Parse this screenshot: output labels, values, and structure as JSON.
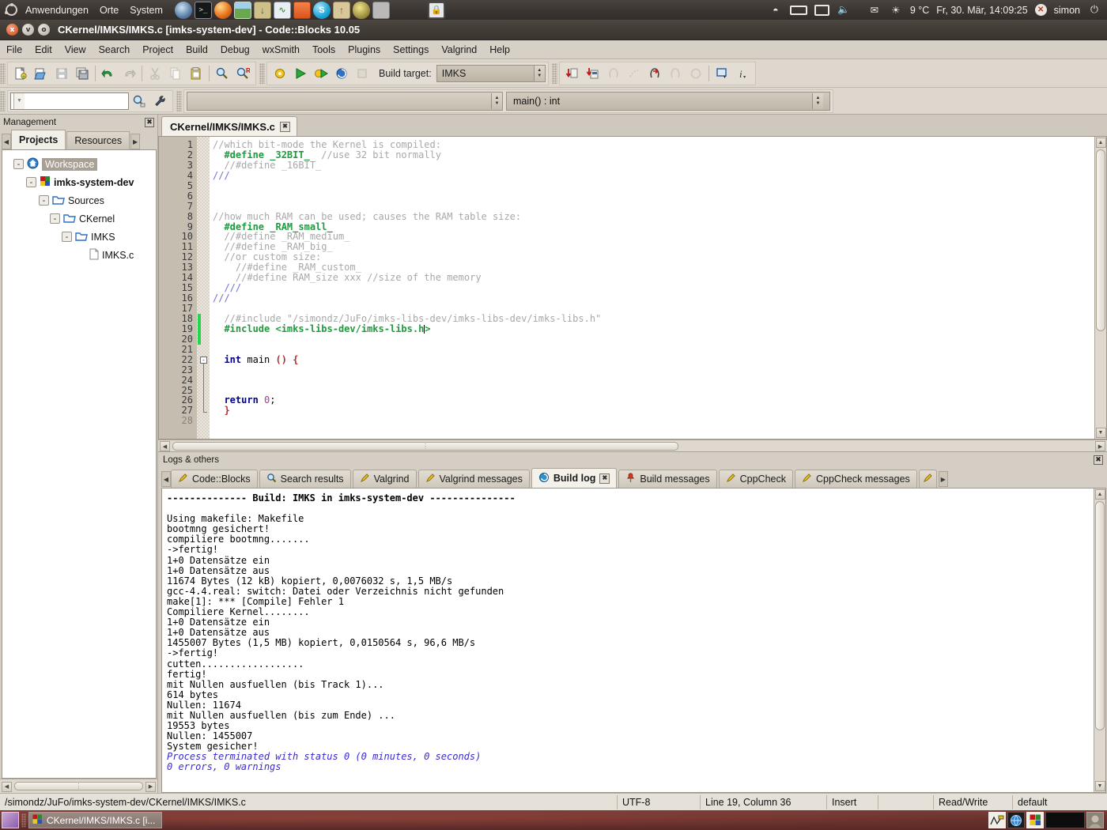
{
  "desktop": {
    "panel": {
      "menus": [
        "Anwendungen",
        "Orte",
        "System"
      ],
      "launchers": [
        "evolution-icon",
        "terminal-icon",
        "firefox-icon",
        "image-viewer-icon",
        "download-icon",
        "system-monitor-icon",
        "file-manager-icon",
        "skype-icon",
        "archive-icon",
        "mouse-icon",
        "calculator-icon",
        "screenlock-icon"
      ],
      "tray": [
        "wifi-icon",
        "battery-icon",
        "display-icon",
        "volume-icon",
        "mail-icon"
      ],
      "weather": "9 °C",
      "clock": "Fr, 30. Mär, 14:09:25",
      "user": "simon",
      "power_icon": "power-icon"
    },
    "taskbar": {
      "show_desktop": "show-desktop-icon",
      "buttons": [
        {
          "label": "CKernel/IMKS/IMKS.c [i...",
          "icon": "codeblocks-icon"
        }
      ],
      "tray": [
        "network-graph-icon",
        "globe-icon",
        "codeblocks-icon",
        "black-icon",
        "face-icon"
      ]
    }
  },
  "window": {
    "title": "CKernel/IMKS/IMKS.c [imks-system-dev] - Code::Blocks 10.05",
    "controls": {
      "close": "x",
      "minimize": "v",
      "maximize": "o"
    }
  },
  "menubar": {
    "items": [
      "File",
      "Edit",
      "View",
      "Search",
      "Project",
      "Build",
      "Debug",
      "wxSmith",
      "Tools",
      "Plugins",
      "Settings",
      "Valgrind",
      "Help"
    ]
  },
  "toolbar": {
    "main_icons": [
      "new-file-icon",
      "open-file-icon",
      "save-icon",
      "save-all-icon",
      "undo-icon",
      "redo-icon",
      "cut-icon",
      "copy-icon",
      "paste-icon",
      "find-icon",
      "replace-icon"
    ],
    "build_icons": [
      "build-icon",
      "run-icon",
      "build-and-run-icon",
      "rebuild-icon",
      "abort-icon"
    ],
    "build_target_label": "Build target:",
    "build_target_value": "IMKS",
    "debug_icons": [
      "debug-step-into-icon",
      "debug-step-out-icon",
      "debug-run-to-cursor-icon",
      "debug-next-line-icon",
      "debug-step-instruction-icon",
      "debug-next-instruction-icon",
      "debug-stop-icon",
      "debug-window-icon",
      "debug-info-icon"
    ],
    "search_placeholder": "",
    "search_value": "",
    "search_icons": [
      "find-in-files-icon",
      "settings-wrench-icon"
    ],
    "goto_value": "",
    "scope_value": "main() : int"
  },
  "management": {
    "header": "Management",
    "close_icon": "close-icon",
    "tabs": [
      {
        "label": "Projects",
        "active": true
      },
      {
        "label": "Resources",
        "active": false
      }
    ],
    "tree": [
      {
        "label": "Workspace",
        "depth": 0,
        "toggle": "-",
        "icon": "workspace-icon",
        "selected": true,
        "bold": false
      },
      {
        "label": "imks-system-dev",
        "depth": 1,
        "toggle": "-",
        "icon": "project-icon",
        "selected": false,
        "bold": true
      },
      {
        "label": "Sources",
        "depth": 2,
        "toggle": "-",
        "icon": "folder-icon",
        "selected": false,
        "bold": false
      },
      {
        "label": "CKernel",
        "depth": 3,
        "toggle": "-",
        "icon": "folder-icon",
        "selected": false,
        "bold": false
      },
      {
        "label": "IMKS",
        "depth": 4,
        "toggle": "-",
        "icon": "folder-icon",
        "selected": false,
        "bold": false
      },
      {
        "label": "IMKS.c",
        "depth": 5,
        "toggle": "",
        "icon": "file-icon",
        "selected": false,
        "bold": false
      }
    ]
  },
  "editor": {
    "tab_label": "CKernel/IMKS/IMKS.c",
    "tab_close_icon": "close-icon",
    "first_line": 1,
    "last_line": 28,
    "lines": [
      {
        "n": 1,
        "tokens": [
          {
            "t": "//which bit-mode the Kernel is compiled:",
            "c": "c-comment"
          }
        ]
      },
      {
        "n": 2,
        "tokens": [
          {
            "t": "  ",
            "c": "c-plain"
          },
          {
            "t": "#define _32BIT_",
            "c": "c-pre"
          },
          {
            "t": "  //use 32 bit normally",
            "c": "c-comment"
          }
        ]
      },
      {
        "n": 3,
        "tokens": [
          {
            "t": "  //#define _16BIT_",
            "c": "c-comment"
          }
        ]
      },
      {
        "n": 4,
        "tokens": [
          {
            "t": "///",
            "c": "c-comment3"
          }
        ]
      },
      {
        "n": 5,
        "tokens": []
      },
      {
        "n": 6,
        "tokens": []
      },
      {
        "n": 7,
        "tokens": []
      },
      {
        "n": 8,
        "tokens": [
          {
            "t": "//how much RAM can be used; causes the RAM table size:",
            "c": "c-comment"
          }
        ]
      },
      {
        "n": 9,
        "tokens": [
          {
            "t": "  ",
            "c": "c-plain"
          },
          {
            "t": "#define _RAM_small_",
            "c": "c-pre"
          }
        ]
      },
      {
        "n": 10,
        "tokens": [
          {
            "t": "  //#define _RAM_medium_",
            "c": "c-comment"
          }
        ]
      },
      {
        "n": 11,
        "tokens": [
          {
            "t": "  //#define _RAM_big_",
            "c": "c-comment"
          }
        ]
      },
      {
        "n": 12,
        "tokens": [
          {
            "t": "  //or custom size:",
            "c": "c-comment"
          }
        ]
      },
      {
        "n": 13,
        "tokens": [
          {
            "t": "    //#define _RAM_custom_",
            "c": "c-comment"
          }
        ]
      },
      {
        "n": 14,
        "tokens": [
          {
            "t": "    //#define RAM_size xxx //size of the memory",
            "c": "c-comment"
          }
        ]
      },
      {
        "n": 15,
        "tokens": [
          {
            "t": "  ///",
            "c": "c-comment3"
          }
        ]
      },
      {
        "n": 16,
        "tokens": [
          {
            "t": "///",
            "c": "c-comment3"
          }
        ]
      },
      {
        "n": 17,
        "tokens": []
      },
      {
        "n": 18,
        "tokens": [
          {
            "t": "  //#include \"/simondz/JuFo/imks-libs-dev/imks-libs-dev/imks-libs.h\"",
            "c": "c-comment"
          }
        ]
      },
      {
        "n": 19,
        "tokens": [
          {
            "t": "  ",
            "c": "c-plain"
          },
          {
            "t": "#include <imks-libs-dev/imks-libs.h",
            "c": "c-pre"
          },
          {
            "t": "CARET",
            "c": "caret"
          },
          {
            "t": ">",
            "c": "c-pre"
          }
        ]
      },
      {
        "n": 20,
        "tokens": []
      },
      {
        "n": 21,
        "tokens": []
      },
      {
        "n": 22,
        "tokens": [
          {
            "t": "  ",
            "c": "c-plain"
          },
          {
            "t": "int",
            "c": "c-kw"
          },
          {
            "t": " main ",
            "c": "c-plain"
          },
          {
            "t": "()",
            "c": "c-op"
          },
          {
            "t": " ",
            "c": "c-plain"
          },
          {
            "t": "{",
            "c": "c-op"
          }
        ]
      },
      {
        "n": 23,
        "tokens": []
      },
      {
        "n": 24,
        "tokens": []
      },
      {
        "n": 25,
        "tokens": []
      },
      {
        "n": 26,
        "tokens": [
          {
            "t": "  ",
            "c": "c-plain"
          },
          {
            "t": "return",
            "c": "c-kw"
          },
          {
            "t": " ",
            "c": "c-plain"
          },
          {
            "t": "0",
            "c": "c-num"
          },
          {
            "t": ";",
            "c": "c-plain"
          }
        ]
      },
      {
        "n": 27,
        "tokens": [
          {
            "t": "  ",
            "c": "c-plain"
          },
          {
            "t": "}",
            "c": "c-op"
          }
        ]
      },
      {
        "n": 28,
        "tokens": []
      }
    ],
    "changed_lines": [
      18,
      19,
      20
    ],
    "fold_start_line": 22,
    "fold_end_line": 27
  },
  "logs": {
    "header": "Logs & others",
    "close_icon": "close-icon",
    "tabs": [
      {
        "label": "Code::Blocks",
        "icon": "pencil-icon",
        "active": false
      },
      {
        "label": "Search results",
        "icon": "search-icon",
        "active": false
      },
      {
        "label": "Valgrind",
        "icon": "pencil-icon",
        "active": false
      },
      {
        "label": "Valgrind messages",
        "icon": "pencil-icon",
        "active": false
      },
      {
        "label": "Build log",
        "icon": "gear-blue-icon",
        "active": true
      },
      {
        "label": "Build messages",
        "icon": "pin-icon",
        "active": false
      },
      {
        "label": "CppCheck",
        "icon": "pencil-icon",
        "active": false
      },
      {
        "label": "CppCheck messages",
        "icon": "pencil-icon",
        "active": false
      }
    ],
    "content": [
      {
        "text": "-------------- Build: IMKS in imks-system-dev ---------------",
        "style": "log-bold"
      },
      {
        "text": "",
        "style": ""
      },
      {
        "text": "Using makefile: Makefile",
        "style": ""
      },
      {
        "text": "bootmng gesichert!",
        "style": ""
      },
      {
        "text": "compiliere bootmng.......",
        "style": ""
      },
      {
        "text": "->fertig!",
        "style": ""
      },
      {
        "text": "1+0 Datensätze ein",
        "style": ""
      },
      {
        "text": "1+0 Datensätze aus",
        "style": ""
      },
      {
        "text": "11674 Bytes (12 kB) kopiert, 0,0076032 s, 1,5 MB/s",
        "style": ""
      },
      {
        "text": "gcc-4.4.real: switch: Datei oder Verzeichnis nicht gefunden",
        "style": ""
      },
      {
        "text": "make[1]: *** [Compile] Fehler 1",
        "style": ""
      },
      {
        "text": "Compiliere Kernel........",
        "style": ""
      },
      {
        "text": "1+0 Datensätze ein",
        "style": ""
      },
      {
        "text": "1+0 Datensätze aus",
        "style": ""
      },
      {
        "text": "1455007 Bytes (1,5 MB) kopiert, 0,0150564 s, 96,6 MB/s",
        "style": ""
      },
      {
        "text": "->fertig!",
        "style": ""
      },
      {
        "text": "cutten..................",
        "style": ""
      },
      {
        "text": "fertig!",
        "style": ""
      },
      {
        "text": "mit Nullen ausfuellen (bis Track 1)...",
        "style": ""
      },
      {
        "text": "614 bytes",
        "style": ""
      },
      {
        "text": "Nullen: 11674",
        "style": ""
      },
      {
        "text": "mit Nullen ausfuellen (bis zum Ende) ...",
        "style": ""
      },
      {
        "text": "19553 bytes",
        "style": ""
      },
      {
        "text": "Nullen: 1455007",
        "style": ""
      },
      {
        "text": "System gesicher!",
        "style": ""
      },
      {
        "text": "Process terminated with status 0 (0 minutes, 0 seconds)",
        "style": "log-blue"
      },
      {
        "text": "0 errors, 0 warnings",
        "style": "log-blue"
      }
    ]
  },
  "statusbar": {
    "path": "/simondz/JuFo/imks-system-dev/CKernel/IMKS/IMKS.c",
    "encoding": "UTF-8",
    "position": "Line 19, Column 36",
    "mode": "Insert",
    "blank": "",
    "access": "Read/Write",
    "profile": "default"
  }
}
